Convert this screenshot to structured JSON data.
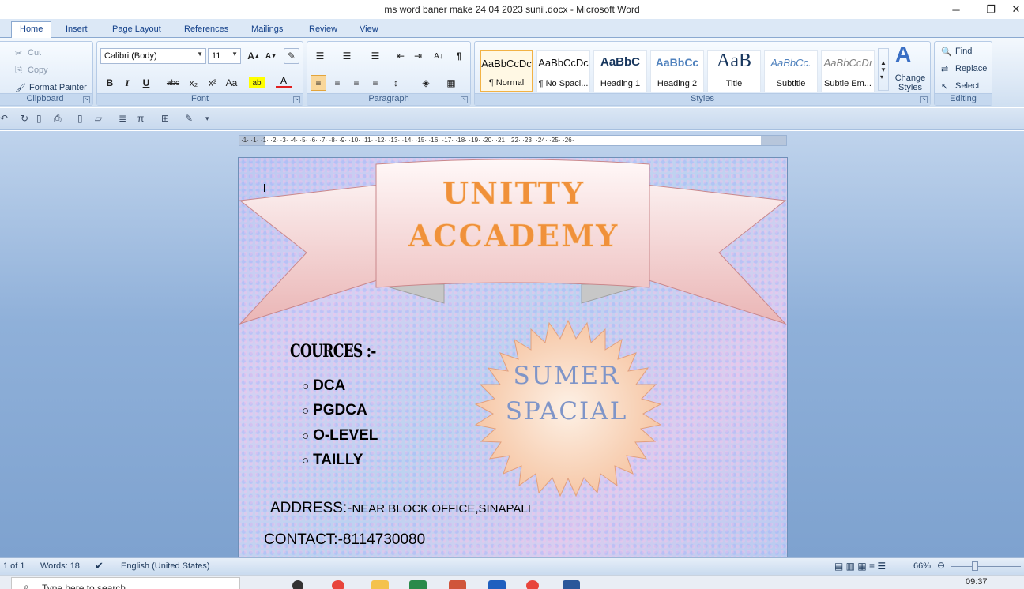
{
  "window": {
    "title": "ms word baner make 24 04 2023 sunil.docx - Microsoft Word",
    "minimize": "─",
    "maximize": "❐",
    "close": "✕"
  },
  "tabs": [
    "Home",
    "Insert",
    "Page Layout",
    "References",
    "Mailings",
    "Review",
    "View"
  ],
  "ribbon": {
    "clipboard": {
      "cut": "Cut",
      "copy": "Copy",
      "format_painter": "Format Painter",
      "label": "Clipboard"
    },
    "font": {
      "family": "Calibri (Body)",
      "size": "11",
      "label": "Font"
    },
    "paragraph": {
      "label": "Paragraph"
    },
    "styles": {
      "label": "Styles",
      "items": [
        {
          "sample": "AaBbCcDc",
          "name": "¶ Normal"
        },
        {
          "sample": "AaBbCcDc",
          "name": "¶ No Spaci..."
        },
        {
          "sample": "AaBbC",
          "name": "Heading 1"
        },
        {
          "sample": "AaBbCc",
          "name": "Heading 2"
        },
        {
          "sample": "AaB",
          "name": "Title"
        },
        {
          "sample": "AaBbCc.",
          "name": "Subtitle"
        },
        {
          "sample": "AaBbCcDı",
          "name": "Subtle Em..."
        }
      ],
      "change_styles": "Change Styles"
    },
    "editing": {
      "find": "Find",
      "replace": "Replace",
      "select": "Select",
      "label": "Editing"
    }
  },
  "ruler": {
    "numbers": "·1· ·1· ·1· ·2· ·3· ·4· ·5· ·6· ·7· ·8· ·9· ·10· ·11· ·12· ·13· ·14· ·15· ·16· ·17· ·18· ·19· ·20· ·21· ·22· ·23· ·24· ·25· ·26·"
  },
  "document": {
    "banner_line1": "UNITTY",
    "banner_line2": "ACCADEMY",
    "starburst_line1": "SUMER",
    "starburst_line2": "SPACIAL",
    "courses_heading": "COURCES :-",
    "courses": [
      "DCA",
      "PGDCA",
      "O-LEVEL",
      "TAILLY"
    ],
    "address_label": "ADDRESS:-",
    "address_value": "NEAR BLOCK OFFICE,SINAPALI",
    "contact": "CONTACT:-8114730080"
  },
  "status": {
    "page": "1 of 1",
    "words": "Words: 18",
    "language": "English (United States)",
    "zoom": "66%"
  },
  "taskbar": {
    "search_placeholder": "Type here to search",
    "clock": "09:37"
  },
  "colors": {
    "banner_text": "#f0913a",
    "starburst_text": "#7f95c8",
    "ribbon_fill": "#f2c9c9"
  }
}
